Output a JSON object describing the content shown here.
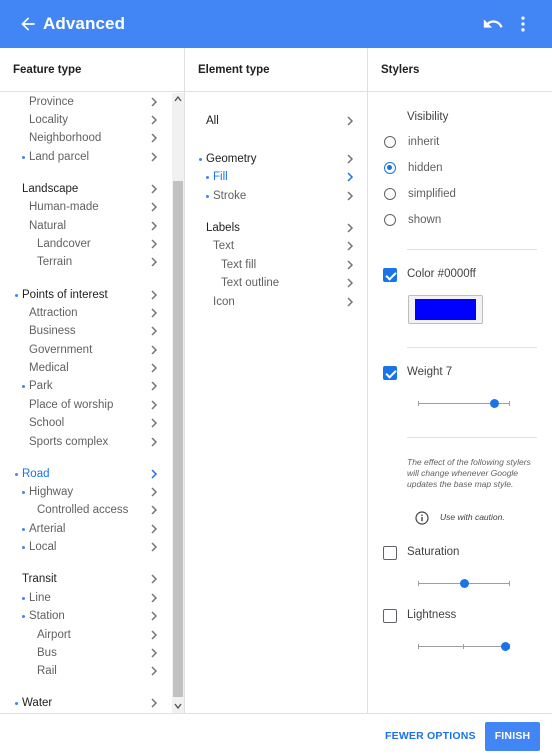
{
  "appbar": {
    "title": "Advanced",
    "back_icon": "arrow-back-icon",
    "undo_icon": "undo-icon",
    "more_icon": "more-vert-icon",
    "color": "#4285f4"
  },
  "columns": {
    "feature_type": "Feature type",
    "element_type": "Element type",
    "stylers": "Stylers"
  },
  "feature_types": [
    {
      "label": "Province",
      "dot": false,
      "state": "normal"
    },
    {
      "label": "Locality",
      "dot": false,
      "state": "normal"
    },
    {
      "label": "Neighborhood",
      "dot": false,
      "state": "normal"
    },
    {
      "label": "Land parcel",
      "dot": true,
      "state": "normal"
    },
    {
      "label": "Landscape",
      "dot": false,
      "state": "bold"
    },
    {
      "label": "Human-made",
      "dot": false,
      "state": "normal"
    },
    {
      "label": "Natural",
      "dot": false,
      "state": "normal"
    },
    {
      "label": "Landcover",
      "dot": false,
      "state": "normal"
    },
    {
      "label": "Terrain",
      "dot": false,
      "state": "normal"
    },
    {
      "label": "Points of interest",
      "dot": true,
      "state": "bold"
    },
    {
      "label": "Attraction",
      "dot": false,
      "state": "normal"
    },
    {
      "label": "Business",
      "dot": false,
      "state": "normal"
    },
    {
      "label": "Government",
      "dot": false,
      "state": "normal"
    },
    {
      "label": "Medical",
      "dot": false,
      "state": "normal"
    },
    {
      "label": "Park",
      "dot": true,
      "state": "normal"
    },
    {
      "label": "Place of worship",
      "dot": false,
      "state": "normal"
    },
    {
      "label": "School",
      "dot": false,
      "state": "normal"
    },
    {
      "label": "Sports complex",
      "dot": false,
      "state": "normal"
    },
    {
      "label": "Road",
      "dot": true,
      "state": "selected"
    },
    {
      "label": "Highway",
      "dot": true,
      "state": "normal"
    },
    {
      "label": "Controlled access",
      "dot": false,
      "state": "normal"
    },
    {
      "label": "Arterial",
      "dot": true,
      "state": "normal"
    },
    {
      "label": "Local",
      "dot": true,
      "state": "normal"
    },
    {
      "label": "Transit",
      "dot": false,
      "state": "bold"
    },
    {
      "label": "Line",
      "dot": true,
      "state": "normal"
    },
    {
      "label": "Station",
      "dot": true,
      "state": "normal"
    },
    {
      "label": "Airport",
      "dot": false,
      "state": "normal"
    },
    {
      "label": "Bus",
      "dot": false,
      "state": "normal"
    },
    {
      "label": "Rail",
      "dot": false,
      "state": "normal"
    },
    {
      "label": "Water",
      "dot": true,
      "state": "bold"
    }
  ],
  "element_types": [
    {
      "label": "All",
      "dot": false,
      "state": "bold"
    },
    {
      "label": "Geometry",
      "dot": true,
      "state": "bold"
    },
    {
      "label": "Fill",
      "dot": true,
      "state": "selected"
    },
    {
      "label": "Stroke",
      "dot": true,
      "state": "normal"
    },
    {
      "label": "Labels",
      "dot": false,
      "state": "bold"
    },
    {
      "label": "Text",
      "dot": false,
      "state": "normal"
    },
    {
      "label": "Text fill",
      "dot": false,
      "state": "normal"
    },
    {
      "label": "Text outline",
      "dot": false,
      "state": "normal"
    },
    {
      "label": "Icon",
      "dot": false,
      "state": "normal"
    }
  ],
  "stylers": {
    "visibility_label": "Visibility",
    "visibility_options": [
      {
        "label": "inherit",
        "checked": false
      },
      {
        "label": "hidden",
        "checked": true
      },
      {
        "label": "simplified",
        "checked": false
      },
      {
        "label": "shown",
        "checked": false
      }
    ],
    "color": {
      "label": "Color #0000ff",
      "checked": true,
      "value": "#0000ff"
    },
    "weight": {
      "label": "Weight 7",
      "checked": true,
      "value": 7,
      "fraction": 0.87
    },
    "note": "The effect of the following stylers will change whenever Google updates the base map style.",
    "caution": "Use with caution.",
    "info_icon": "info-icon",
    "saturation": {
      "label": "Saturation",
      "checked": false,
      "fraction": 0.5
    },
    "lightness": {
      "label": "Lightness",
      "checked": false,
      "fraction": 1.0
    }
  },
  "footer": {
    "fewer_options": "FEWER OPTIONS",
    "finish": "FINISH"
  },
  "accent_color": "#1a73e8"
}
